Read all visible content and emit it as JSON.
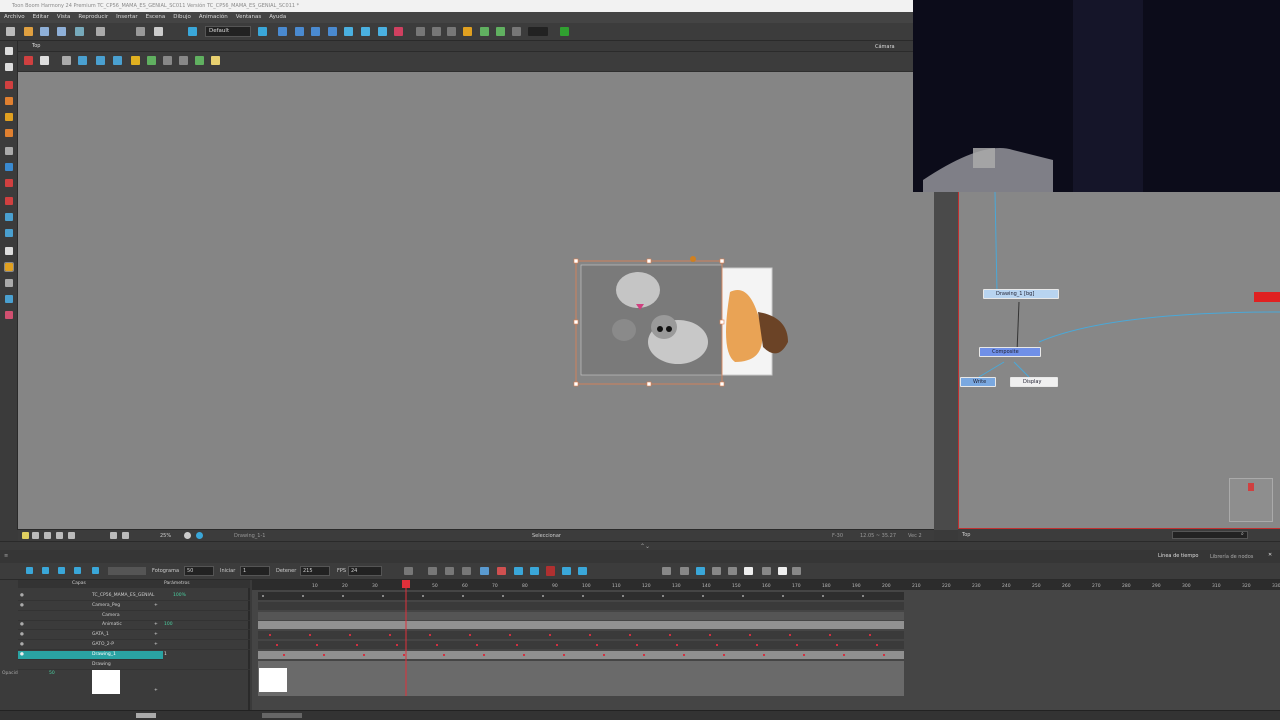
{
  "window": {
    "title": "Toon Boom Harmony 24 Premium TC_CP56_MAMA_ES_GENIAL_SC011 Versión TC_CP56_MAMA_ES_GENIAL_SC011 *"
  },
  "menu": [
    "Archivo",
    "Editar",
    "Vista",
    "Reproducir",
    "Insertar",
    "Escena",
    "Dibujo",
    "Animación",
    "Ventanas",
    "Ayuda"
  ],
  "toolbar": {
    "workspace_select": "Default"
  },
  "camera_view": {
    "tab_label": "Top",
    "right_tab": "Cámara",
    "status_tool": "Seleccionar",
    "zoom": "25%",
    "status_layer": "Drawing_1-1",
    "status_frame": "F-30",
    "status_coords": "12.05 ~ 35.27",
    "status_view": "Vec 2"
  },
  "node_view": {
    "status_label": "Top",
    "nodes": {
      "drawing": "Drawing_1 [bg]",
      "composite": "Composite",
      "write": "Write",
      "display": "Display"
    }
  },
  "timeline_panel": {
    "tabs": [
      "Línea de tiempo",
      "Librería de nodos"
    ],
    "frame_label": "Fotograma",
    "frame_value": "50",
    "start_label": "Iniciar",
    "start_value": "1",
    "stop_label": "Detener",
    "stop_value": "215",
    "fps_label": "FPS",
    "fps_value": "24"
  },
  "layer_panel": {
    "header_layers": "Capas",
    "header_params": "Parámetros",
    "layers": [
      {
        "name": "TC_CP56_MAMA_ES_GENIAL",
        "value": "100%"
      },
      {
        "name": "Camera_Peg",
        "value": ""
      },
      {
        "name": "Camera",
        "value": ""
      },
      {
        "name": "Animatic",
        "value": "100"
      },
      {
        "name": "GATA_1",
        "value": ""
      },
      {
        "name": "GATO_2-P",
        "value": ""
      },
      {
        "name": "Drawing_1",
        "value": "1"
      },
      {
        "name": "Drawing",
        "value": ""
      }
    ],
    "opacity_label": "Opacidad",
    "opacity_value": "50"
  },
  "ruler_ticks": [
    "10",
    "20",
    "30",
    "40",
    "50",
    "60",
    "70",
    "80",
    "90",
    "100",
    "110",
    "120",
    "130",
    "140",
    "150",
    "160",
    "170",
    "180",
    "190",
    "200",
    "210",
    "220",
    "230",
    "240",
    "250",
    "260",
    "270",
    "280",
    "290",
    "300",
    "310",
    "320",
    "330"
  ],
  "colors": {
    "accent": "#3aa7d9",
    "playhead": "#e0303a",
    "selected_layer": "#2aa3a3",
    "viewport_bg": "#858585"
  }
}
